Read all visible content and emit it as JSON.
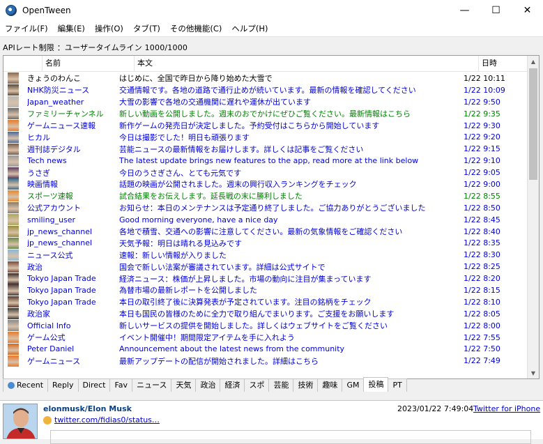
{
  "window": {
    "title": "OpenTween",
    "minimize": "—",
    "maximize": "☐",
    "close": "✕"
  },
  "menu": [
    "ファイル(F)",
    "編集(E)",
    "操作(O)",
    "タブ(T)",
    "その他機能(C)",
    "ヘルプ(H)"
  ],
  "status_line": "APIレート制限 ：ユーザータイムライン 1000/1000",
  "list": {
    "columns": [
      "名前",
      "本文",
      "日時"
    ],
    "rows": [
      {
        "name": "きょうのわんこ",
        "text": "はじめに、全国で昨日から降り始めた大雪で",
        "date": "1/22 10:11",
        "color": "black",
        "avatar": "#8a6a4f"
      },
      {
        "name": "NHK防災ニュース",
        "text": "交通情報です。各地の道路で通行止めが続いています。最新の情報を確認してください",
        "date": "1/22 10:09",
        "color": "blue",
        "avatar": "#5a4a3a"
      },
      {
        "name": "Japan_weather",
        "text": "大雪の影響で各地の交通機関に遅れや運休が出ています",
        "date": "1/22 9:50",
        "color": "blue",
        "avatar": "#b8b8b8"
      },
      {
        "name": "ファミリーチャンネル",
        "text": "新しい動画を公開しました。週末のおでかけにぜひご覧ください。最新情報はこちら",
        "date": "1/22 9:35",
        "color": "green",
        "avatar": "#6a6a6a"
      },
      {
        "name": "ゲームニュース速報",
        "text": "新作ゲームの発売日が決定しました。予約受付はこちらから開始しています",
        "date": "1/22 9:30",
        "color": "blue",
        "avatar": "#e87a2a"
      },
      {
        "name": "ヒカル",
        "text": "今日は撮影でした！明日も頑張ります",
        "date": "1/22 9:20",
        "color": "blue",
        "avatar": "#4a6a9a"
      },
      {
        "name": "週刊誌デジタル",
        "text": "芸能ニュースの最新情報をお届けします。詳しくは記事をご覧ください",
        "date": "1/22 9:15",
        "color": "blue",
        "avatar": "#7a5a4a"
      },
      {
        "name": "Tech news",
        "text": "The latest update brings new features to the app, read more at the link below",
        "date": "1/22 9:10",
        "color": "blue",
        "avatar": "#9a9a9a"
      },
      {
        "name": "うさぎ",
        "text": "今日のうさぎさん、とても元気です",
        "date": "1/22 9:05",
        "color": "blue",
        "avatar": "#5a3a5a"
      },
      {
        "name": "映画情報",
        "text": "話題の映画が公開されました。週末の興行収入ランキングをチェック",
        "date": "1/22 9:00",
        "color": "blue",
        "avatar": "#3a6a8a"
      },
      {
        "name": "スポーツ速報",
        "text": "試合結果をお伝えします。延長戦の末に勝利しました",
        "date": "1/22 8:55",
        "color": "green",
        "avatar": "#e8882a"
      },
      {
        "name": "公式アカウント",
        "text": "お知らせ：本日のメンテナンスは予定通り終了しました。ご協力ありがとうございました",
        "date": "1/22 8:50",
        "color": "blue",
        "avatar": "#8a7a6a"
      },
      {
        "name": "smiling_user",
        "text": "Good morning everyone, have a nice day",
        "date": "1/22 8:45",
        "color": "blue",
        "avatar": "#a8a85a"
      },
      {
        "name": "jp_news_channel",
        "text": "各地で積雪、交通への影響に注意してください。最新の気象情報をご確認ください",
        "date": "1/22 8:40",
        "color": "blue",
        "avatar": "#9a8a3a"
      },
      {
        "name": "jp_news_channel",
        "text": "天気予報：明日は晴れる見込みです",
        "date": "1/22 8:35",
        "color": "blue",
        "avatar": "#6a8a4a"
      },
      {
        "name": "ニュース公式",
        "text": "速報：新しい情報が入りました",
        "date": "1/22 8:30",
        "color": "blue",
        "avatar": "#8ab8d8"
      },
      {
        "name": "政治",
        "text": "国会で新しい法案が審議されています。詳細は公式サイトで",
        "date": "1/22 8:25",
        "color": "blue",
        "avatar": "#7a4a3a"
      },
      {
        "name": "Tokyo Japan Trade",
        "text": "経済ニュース：株価が上昇しました。市場の動向に注目が集まっています",
        "date": "1/22 8:20",
        "color": "blue",
        "avatar": "#3a2a2a"
      },
      {
        "name": "Tokyo Japan Trade",
        "text": "為替市場の最新レポートを公開しました",
        "date": "1/22 8:15",
        "color": "blue",
        "avatar": "#4a3a3a"
      },
      {
        "name": "Tokyo Japan Trade",
        "text": "本日の取引終了後に決算発表が予定されています。注目の銘柄をチェック",
        "date": "1/22 8:10",
        "color": "blue",
        "avatar": "#5a3a2a"
      },
      {
        "name": "政治家",
        "text": "本日も国民の皆様のために全力で取り組んでまいります。ご支援をお願いします",
        "date": "1/22 8:05",
        "color": "blue",
        "avatar": "#3a3a3a"
      },
      {
        "name": "Official Info",
        "text": "新しいサービスの提供を開始しました。詳しくはウェブサイトをご覧ください",
        "date": "1/22 8:00",
        "color": "blue",
        "avatar": "#8a8a8a"
      },
      {
        "name": "ゲーム公式",
        "text": "イベント開催中！期間限定アイテムを手に入れよう",
        "date": "1/22 7:55",
        "color": "blue",
        "avatar": "#e87a2a"
      },
      {
        "name": "Peter Daniel",
        "text": "Announcement about the latest news from the community",
        "date": "1/22 7:50",
        "color": "blue",
        "avatar": "#d86a1a"
      },
      {
        "name": "ゲームニュース",
        "text": "最新アップデートの配信が開始されました。詳細はこちら",
        "date": "1/22 7:49",
        "color": "blue",
        "avatar": "#e8782a"
      }
    ]
  },
  "tabs": [
    "Recent",
    "Reply",
    "Direct",
    "Fav",
    "ニュース",
    "天気",
    "政治",
    "経済",
    "スポ",
    "芸能",
    "技術",
    "趣味",
    "GM",
    "投稿",
    "PT"
  ],
  "detail": {
    "name": "elonmusk/Elon Musk",
    "link": "twitter.com/fidias0/status…",
    "date": "2023/01/22 7:49:04",
    "source": "Twitter for iPhone"
  }
}
